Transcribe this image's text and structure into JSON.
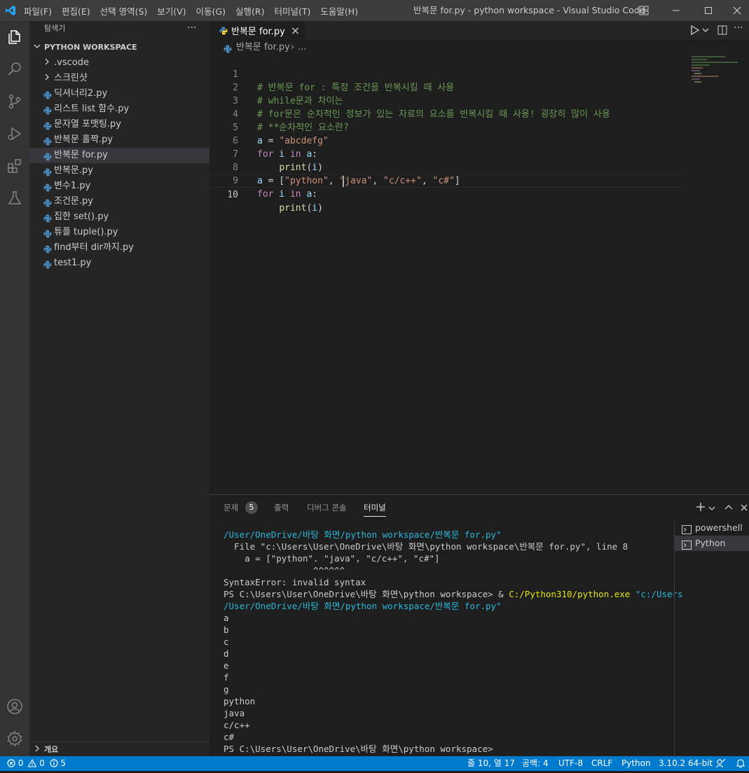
{
  "window": {
    "title": "반복문 for.py - python workspace - Visual Studio Code",
    "menu": [
      "파일(F)",
      "편집(E)",
      "선택 영역(S)",
      "보기(V)",
      "이동(G)",
      "실행(R)",
      "터미널(T)",
      "도움말(H)"
    ]
  },
  "sidebar": {
    "header": "탐색기",
    "more": "···",
    "folder": "PYTHON WORKSPACE",
    "folders": [
      ".vscode",
      "스크린샷"
    ],
    "files": [
      "딕셔너리2.py",
      "리스트 list 함수.py",
      "문자열 포맷팅.py",
      "반복문 홀짝.py",
      "반복문 for.py",
      "반복문.py",
      "변수1.py",
      "조건문.py",
      "집한 set().py",
      "튜플 tuple().py",
      "find부터 dir까지.py",
      "test1.py"
    ],
    "selected_file": "반복문 for.py",
    "outline": "개요"
  },
  "editor": {
    "tab_label": "반복문 for.py",
    "close_glyph": "×",
    "breadcrumb_file": "반복문 for.py",
    "breadcrumb_sep": "›",
    "breadcrumb_more": "...",
    "line_numbers": [
      "1",
      "2",
      "3",
      "4",
      "5",
      "6",
      "7",
      "8",
      "9",
      "10"
    ],
    "line1": "# 반복문 for : 특정 조건을 반복시킬 때 사용",
    "line2": "# while문과 차이는",
    "line3": "# for문은 순차적인 정보가 있는 자료의 요소를 반복시킬 때 사용! 굉장히 많이 사용",
    "line4": "# **순차적인 요소란?",
    "line5": {
      "var": "a",
      "op": " = ",
      "str": "\"abcdefg\""
    },
    "line6": {
      "kw1": "for",
      "var1": " i ",
      "kw2": "in",
      "var2": " a",
      "colon": ":"
    },
    "line7": {
      "indent": "    ",
      "fn": "print",
      "open": "(",
      "arg": "i",
      "close": ")"
    },
    "line8": {
      "var": "a",
      "op": " = [",
      "s1": "\"python\"",
      "c1": ", ",
      "s2": "\"java\"",
      "c2": ", ",
      "s3": "\"c/c++\"",
      "c3": ", ",
      "s4": "\"c#\"",
      "end": "]"
    },
    "line9": {
      "kw1": "for",
      "var1": " i ",
      "kw2": "in",
      "var2": " a",
      "colon": ":"
    },
    "line10": {
      "indent": "    ",
      "fn": "print",
      "open": "(",
      "arg": "i",
      "close": ")"
    }
  },
  "panel": {
    "tabs": {
      "problems": "문제",
      "problems_count": "5",
      "output": "출력",
      "debug": "디버그 콘솔",
      "terminal": "터미널"
    },
    "terminal_lines": {
      "l1": "/User/OneDrive/바탕 화면/python workspace/반복문 for.py\"",
      "l2": "  File \"c:\\Users\\User\\OneDrive\\바탕 화면\\python workspace\\반복문 for.py\", line 8",
      "l3": "    a = [\"python\". \"java\", \"c/c++\", \"c#\"]",
      "l4": "                 ^^^^^^",
      "l5": "SyntaxError: invalid syntax",
      "l6_prompt": "PS C:\\Users\\User\\OneDrive\\바탕 화면\\python workspace> & ",
      "l6_exe": "C:/Python310/python.exe",
      "l6_arg": " \"c:/Users",
      "l7": "/User/OneDrive/바탕 화면/python workspace/반복문 for.py\"",
      "outputs": [
        "a",
        "b",
        "c",
        "d",
        "e",
        "f",
        "g",
        "python",
        "java",
        "c/c++",
        "c#"
      ],
      "last": "PS C:\\Users\\User\\OneDrive\\바탕 화면\\python workspace>"
    },
    "terminals": [
      "powershell",
      "Python"
    ],
    "selected_terminal": "Python"
  },
  "status": {
    "errors": "0",
    "warnings": "0",
    "info": "5",
    "position": "줄 10, 열 17",
    "spaces": "공백: 4",
    "encoding": "UTF-8",
    "eol": "CRLF",
    "language": "Python",
    "interpreter": "3.10.2 64-bit"
  },
  "colors": {
    "accent": "#007acc",
    "titlebar": "#3c3c3c",
    "activitybar": "#333333",
    "sidebar": "#252526",
    "editor": "#1e1e1e",
    "python_icon": "#4b8bbe"
  }
}
